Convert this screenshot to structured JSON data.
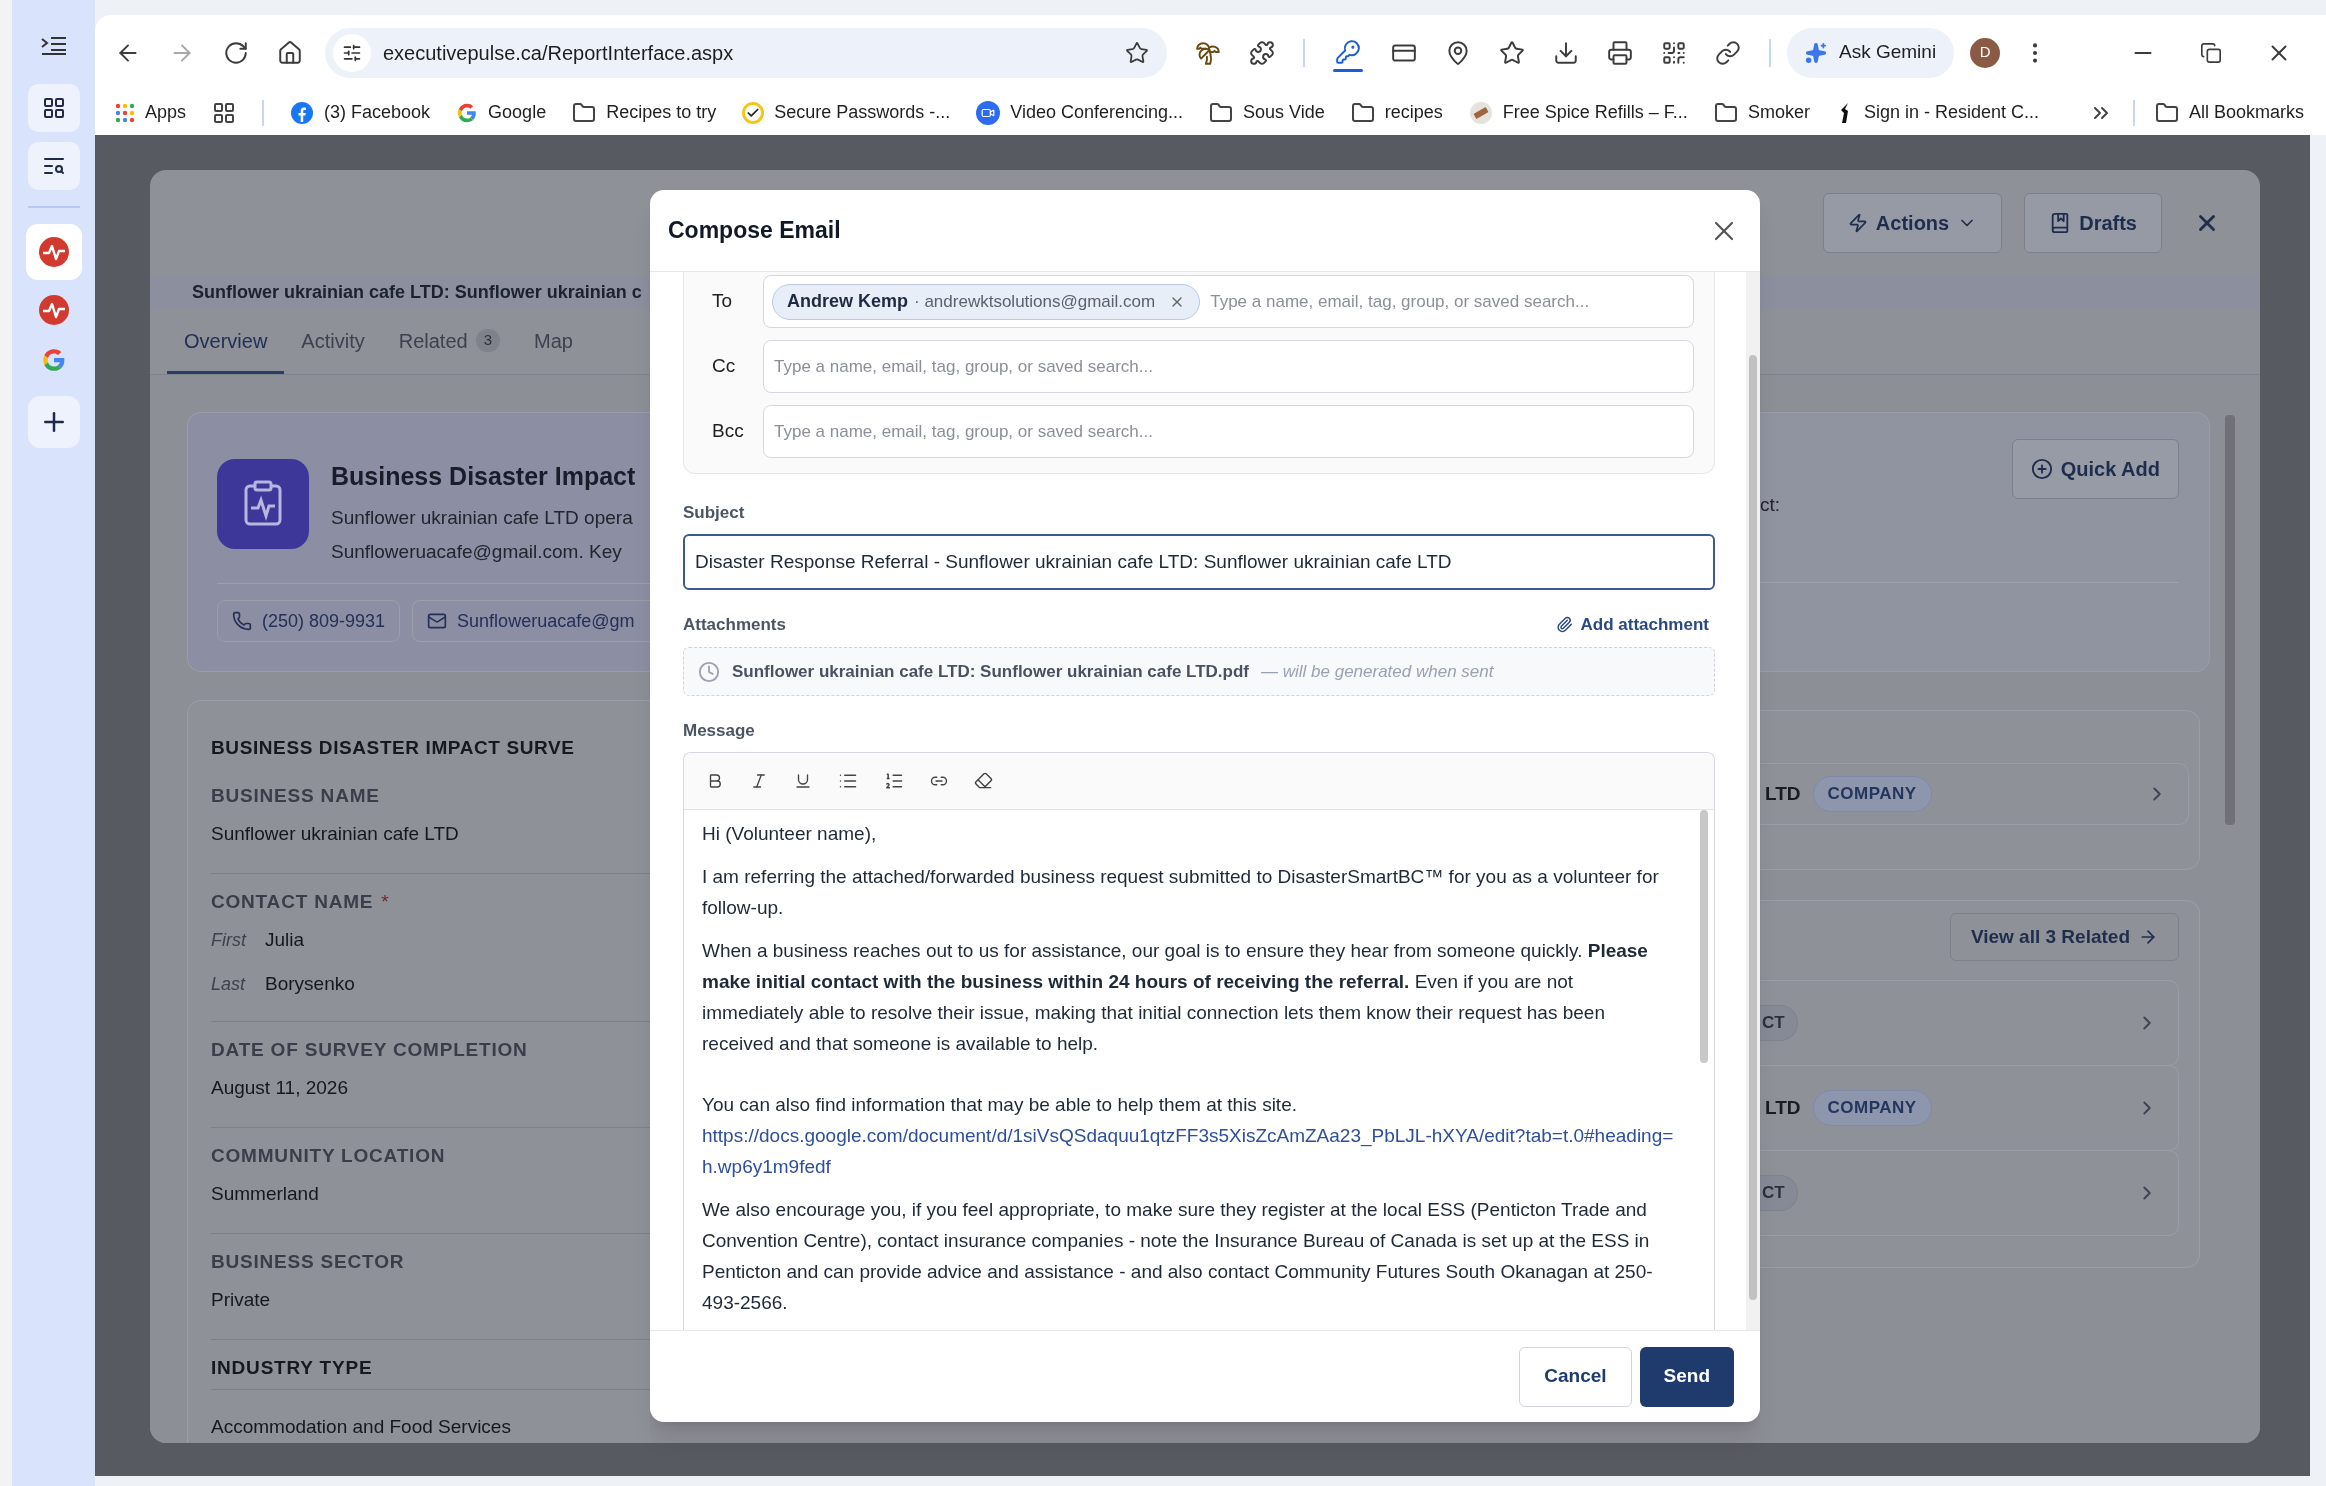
{
  "browser": {
    "url": "executivepulse.ca/ReportInterface.aspx",
    "ask_button": "Ask Gemini",
    "avatar": "D",
    "all_bookmarks": "All Bookmarks",
    "bookmarks": [
      {
        "kind": "apps",
        "label": "Apps"
      },
      {
        "kind": "groups"
      },
      {
        "kind": "facebook",
        "label": "(3) Facebook"
      },
      {
        "kind": "google",
        "label": "Google"
      },
      {
        "kind": "folder",
        "label": "Recipes to try"
      },
      {
        "kind": "passwords",
        "label": "Secure Passwords -..."
      },
      {
        "kind": "video",
        "label": "Video Conferencing..."
      },
      {
        "kind": "folder",
        "label": "Sous Vide"
      },
      {
        "kind": "folder",
        "label": "recipes"
      },
      {
        "kind": "spice",
        "label": "Free Spice Refills – F..."
      },
      {
        "kind": "folder",
        "label": "Smoker"
      },
      {
        "kind": "resident",
        "label": "Sign in - Resident C..."
      }
    ]
  },
  "record": {
    "title": "Sunflower ukrainian cafe LTD: Sunflower ukrainian c",
    "header_buttons": [
      {
        "kind": "actions",
        "label": "Actions"
      },
      {
        "kind": "drafts",
        "label": "Drafts"
      }
    ],
    "tabs": [
      {
        "label": "Overview",
        "selected": true
      },
      {
        "label": "Activity",
        "selected": false
      },
      {
        "label": "Related",
        "count": "3",
        "selected": false
      },
      {
        "label": "Map",
        "selected": false
      }
    ],
    "summary": {
      "title": "Business Disaster Impact",
      "lines": [
        "Sunflower ukrainian cafe LTD opera",
        "Sunfloweruacafe@gmail.com. Key"
      ],
      "phone": "(250) 809-9931",
      "email": "Sunfloweruacafe@gm",
      "quick_add": "Quick Add",
      "fragment": "ct:"
    },
    "survey": {
      "title": "BUSINESS DISASTER IMPACT SURVE",
      "fields": [
        {
          "kind": "text",
          "label": "BUSINESS NAME",
          "value": "Sunflower ukrainian cafe LTD"
        },
        {
          "kind": "name",
          "label": "CONTACT NAME",
          "mark": "*",
          "parts": [
            {
              "label": "First",
              "value": "Julia"
            },
            {
              "label": "Last",
              "value": "Borysenko"
            }
          ]
        },
        {
          "kind": "text",
          "label": "DATE OF SURVEY COMPLETION",
          "value": "August 11, 2026"
        },
        {
          "kind": "text",
          "label": "COMMUNITY LOCATION",
          "value": "Summerland"
        },
        {
          "kind": "text",
          "label": "BUSINESS SECTOR",
          "value": "Private"
        },
        {
          "kind": "section",
          "label": "INDUSTRY TYPE",
          "value": "Accommodation and Food Services"
        }
      ]
    },
    "linked": {
      "rows": [
        {
          "name": "LTD",
          "tag": "COMPANY"
        }
      ]
    },
    "related": {
      "button": "View all 3 Related",
      "rows": [
        {
          "tag": "CT"
        },
        {
          "name": "LTD",
          "tag": "COMPANY"
        },
        {
          "tag": "CT"
        }
      ]
    }
  },
  "compose": {
    "title": "Compose Email",
    "recipients": [
      {
        "label": "To",
        "chips": [
          {
            "name": "Andrew Kemp",
            "email": "· andrewktsolutions@gmail.com"
          }
        ],
        "placeholder": "Type a name, email, tag, group, or saved search..."
      },
      {
        "label": "Cc",
        "placeholder": "Type a name, email, tag, group, or saved search..."
      },
      {
        "label": "Bcc",
        "placeholder": "Type a name, email, tag, group, or saved search..."
      }
    ],
    "subject": {
      "label": "Subject",
      "value": "Disaster Response Referral - Sunflower ukrainian cafe LTD: Sunflower ukrainian cafe LTD"
    },
    "attachments": {
      "label": "Attachments",
      "add": "Add attachment",
      "files": [
        {
          "name": "Sunflower ukrainian cafe LTD: Sunflower ukrainian cafe LTD.pdf",
          "note": "— will be generated when sent"
        }
      ]
    },
    "message": {
      "label": "Message",
      "blocks": [
        {
          "kind": "text",
          "text": "Hi (Volunteer name),"
        },
        {
          "kind": "text",
          "text": "I am referring the attached/forwarded business request submitted to DisasterSmartBC™ for you as a volunteer for follow-up."
        },
        {
          "kind": "text",
          "text": "When a business reaches out to us for assistance, our goal is to ensure they hear from someone quickly. **Please make initial contact with the business within 24 hours of receiving the referral.** Even if you are not immediately able to resolve their issue, making that initial connection lets them know their request has been received and that someone is available to help."
        },
        {
          "kind": "link_block",
          "text": "You can also find information that may be able to help them at this site.",
          "link": "https://docs.google.com/document/d/1siVsQSdaquu1qtzFF3s5XisZcAmZAa23_PbLJL-hXYA/edit?tab=t.0#heading=h.wp6y1m9fedf"
        },
        {
          "kind": "text",
          "text": "We also encourage you, if you feel appropriate, to make sure they register at the local ESS (Penticton Trade and Convention Centre), contact insurance companies - note the Insurance Bureau of Canada is set up at the ESS in Penticton and can provide advice and assistance - and also contact Community Futures South Okanagan at 250-493-2566."
        }
      ]
    },
    "buttons": [
      {
        "kind": "cancel",
        "label": "Cancel"
      },
      {
        "kind": "send",
        "label": "Send"
      }
    ]
  }
}
